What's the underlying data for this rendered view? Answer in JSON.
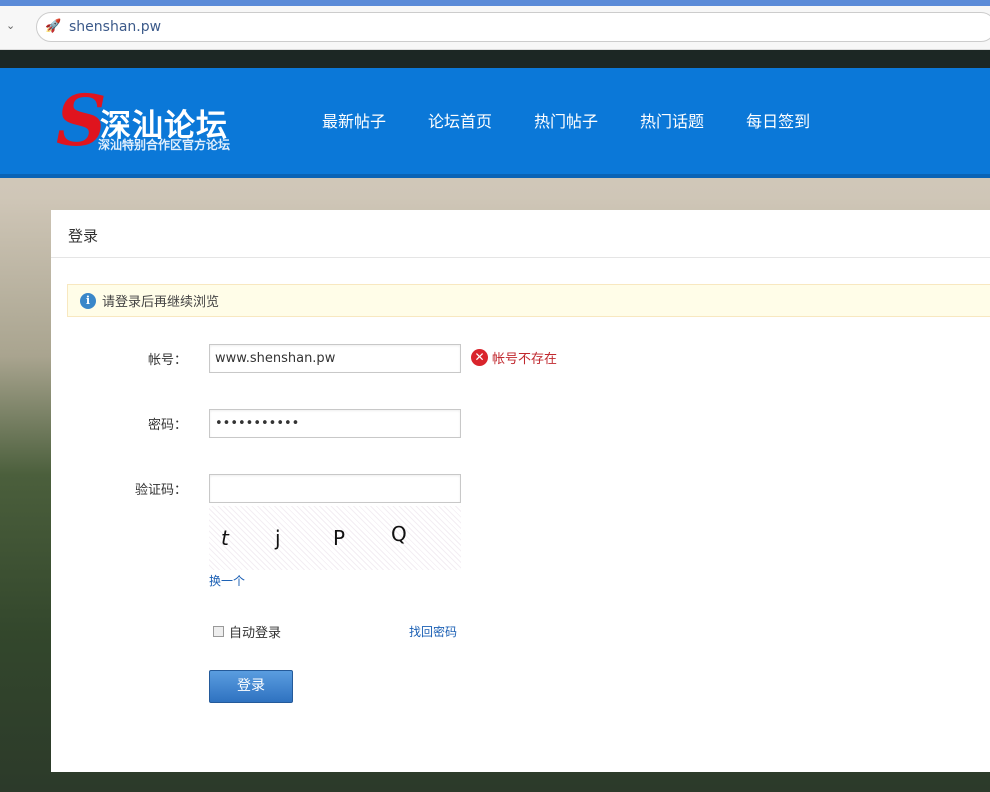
{
  "browser": {
    "url": "shenshan.pw"
  },
  "header": {
    "logo_title": "深汕论坛",
    "logo_subtitle": "深汕特别合作区官方论坛",
    "nav": [
      "最新帖子",
      "论坛首页",
      "热门帖子",
      "热门话题",
      "每日签到"
    ]
  },
  "login": {
    "title": "登录",
    "notice": "请登录后再继续浏览",
    "account_label": "帐号：",
    "account_value": "www.shenshan.pw",
    "account_error": "帐号不存在",
    "password_label": "密码：",
    "password_value": "...........",
    "captcha_label": "验证码：",
    "captcha_value": "",
    "captcha_chars": [
      "t",
      "j",
      "P",
      "Q"
    ],
    "captcha_refresh": "换一个",
    "remember_label": "自动登录",
    "forgot_link": "找回密码",
    "submit": "登录"
  }
}
